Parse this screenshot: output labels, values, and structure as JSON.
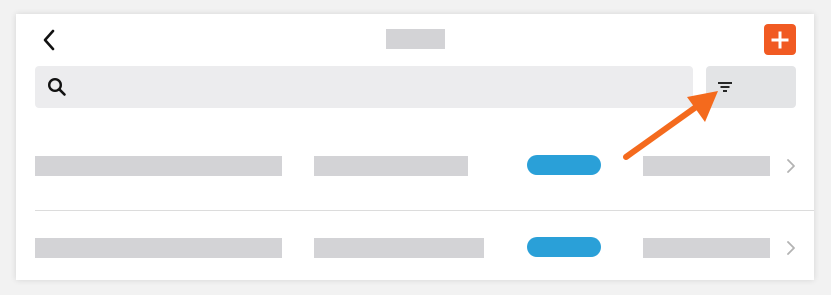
{
  "header": {
    "back_icon": "chevron-left-icon",
    "add_icon": "plus-icon"
  },
  "search": {
    "placeholder": "",
    "icon": "search-icon"
  },
  "filter": {
    "icon": "filter-icon"
  },
  "list": {
    "chevron_icon": "chevron-right-icon"
  },
  "annotation": {
    "icon": "arrow-pointer",
    "points_to": "filter-button"
  },
  "colors": {
    "accent": "#f15a22",
    "badge": "#2aa0d8",
    "placeholder": "#d3d3d6",
    "search_background": "#ececee",
    "filter_background": "#e3e4e6",
    "annotation_arrow": "#f46a1d"
  }
}
